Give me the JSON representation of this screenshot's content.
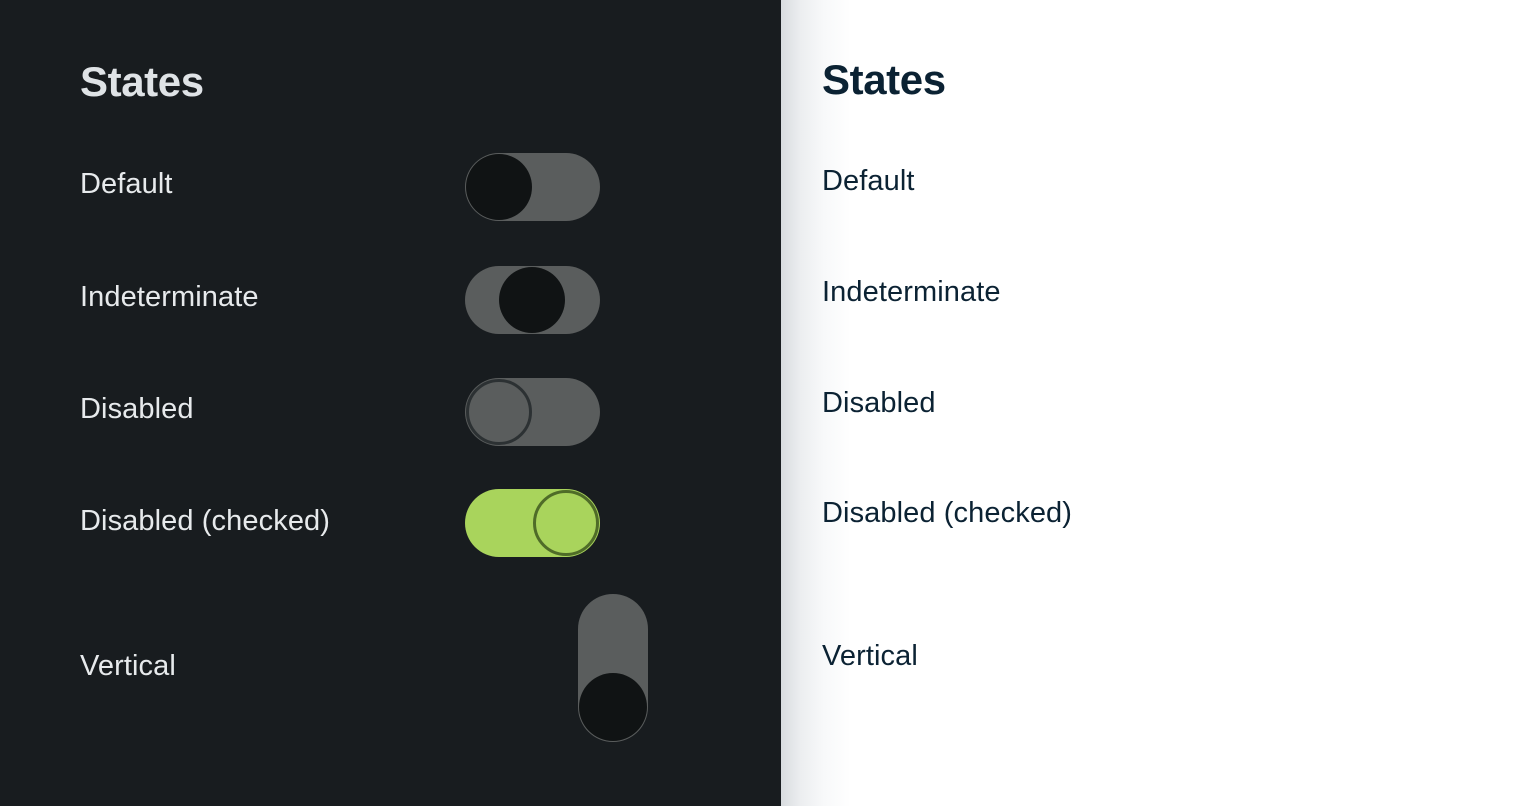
{
  "panels": {
    "dark": {
      "theme_name": "dark",
      "background": "#181c1f",
      "heading": "States",
      "heading_color": "#dfe3e6",
      "label_color": "#e7eaec",
      "track_color": "#5a5d5d",
      "knob_color": "#101314",
      "accent_green": "#a9d45c",
      "rows": [
        {
          "label": "Default",
          "state": "off",
          "knob": "filled",
          "position": "left"
        },
        {
          "label": "Indeterminate",
          "state": "indeterminate",
          "knob": "filled",
          "position": "center"
        },
        {
          "label": "Disabled",
          "state": "disabled",
          "knob": "outline",
          "position": "left"
        },
        {
          "label": "Disabled (checked)",
          "state": "disabled-on",
          "knob": "outline",
          "position": "right"
        },
        {
          "label": "Vertical",
          "state": "vertical-off",
          "knob": "filled",
          "position": "bottom"
        }
      ]
    },
    "light": {
      "theme_name": "light",
      "background": "#ffffff",
      "heading": "States",
      "heading_color": "#0b2233",
      "label_color": "#0b2233",
      "track_color": "#cccccc",
      "knob_color": "#ffffff",
      "accent_green": "#85bd2e",
      "rows": [
        {
          "label": "Default",
          "state": "off",
          "knob": "filled",
          "position": "left"
        },
        {
          "label": "Indeterminate",
          "state": "indeterminate",
          "knob": "filled",
          "position": "center"
        },
        {
          "label": "Disabled",
          "state": "disabled",
          "knob": "outline",
          "position": "left"
        },
        {
          "label": "Disabled (checked)",
          "state": "disabled-on",
          "knob": "outline",
          "position": "right"
        },
        {
          "label": "Vertical",
          "state": "vertical-off",
          "knob": "filled",
          "position": "bottom"
        }
      ]
    }
  }
}
